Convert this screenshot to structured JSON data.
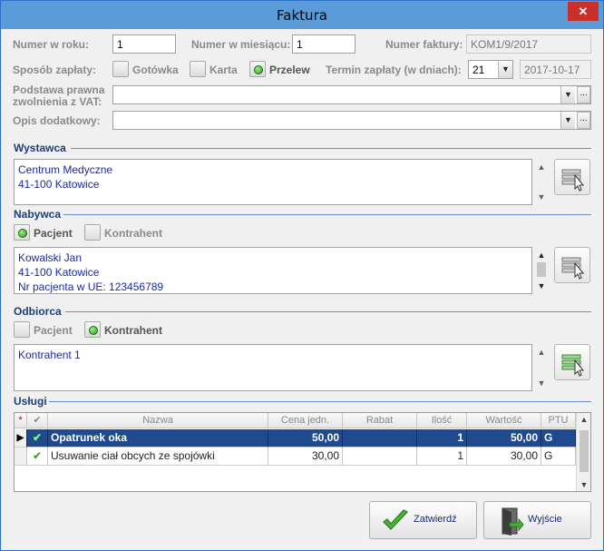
{
  "window": {
    "title": "Faktura",
    "close": "✕"
  },
  "fields": {
    "numer_w_roku": {
      "label": "Numer w roku:",
      "value": "1"
    },
    "numer_w_miesiacu": {
      "label": "Numer w miesiącu:",
      "value": "1"
    },
    "numer_faktury": {
      "label": "Numer faktury:",
      "value": "KOM1/9/2017"
    },
    "sposob_zaplaty": {
      "label": "Sposób zapłaty:",
      "gotowka": "Gotówka",
      "karta": "Karta",
      "przelew": "Przelew",
      "selected": "Przelew"
    },
    "termin_zaplaty": {
      "label": "Termin zapłaty (w dniach):",
      "value": "21",
      "date": "2017-10-17"
    },
    "podstawa_prawna": {
      "label_line1": "Podstawa prawna",
      "label_line2": "zwolnienia z VAT:",
      "value": ""
    },
    "opis_dodatkowy": {
      "label": "Opis dodatkowy:",
      "value": ""
    }
  },
  "wystawca": {
    "title": "Wystawca",
    "lines": [
      "Centrum Medyczne",
      "41-100 Katowice"
    ]
  },
  "nabywca": {
    "title": "Nabywca",
    "opt_pacjent": "Pacjent",
    "opt_kontrahent": "Kontrahent",
    "selected": "Pacjent",
    "lines": [
      "Kowalski Jan",
      "41-100 Katowice",
      "Nr pacjenta w UE: 123456789"
    ]
  },
  "odbiorca": {
    "title": "Odbiorca",
    "opt_pacjent": "Pacjent",
    "opt_kontrahent": "Kontrahent",
    "selected": "Kontrahent",
    "lines": [
      "Kontrahent 1"
    ]
  },
  "uslugi": {
    "title": "Usługi",
    "columns": [
      "*",
      "✔",
      "Nazwa",
      "Cena jedn.",
      "Rabat",
      "Ilość",
      "Wartość",
      "PTU"
    ],
    "rows": [
      {
        "check": "✔",
        "nazwa": "Opatrunek oka",
        "cena": "50,00",
        "rabat": "",
        "ilosc": "1",
        "wartosc": "50,00",
        "ptu": "G",
        "selected": true
      },
      {
        "check": "✔",
        "nazwa": "Usuwanie ciał obcych ze spojówki",
        "cena": "30,00",
        "rabat": "",
        "ilosc": "1",
        "wartosc": "30,00",
        "ptu": "G",
        "selected": false
      }
    ]
  },
  "buttons": {
    "zatwierdz": "Zatwierdź",
    "wyjscie": "Wyjście"
  },
  "colors": {
    "accent": "#1f4a8f",
    "section": "#1f3f7a",
    "memo_text": "#1a2aa0",
    "radio_on": "#2a9a1a"
  }
}
